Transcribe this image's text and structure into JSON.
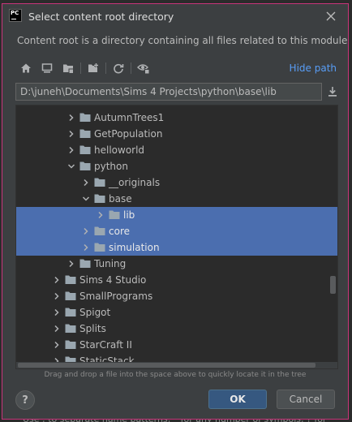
{
  "backdrop": {
    "text": "Use ; to separate name patterns, * for any number of symbols, ? for"
  },
  "dialog": {
    "title": "Select content root directory",
    "description": "Content root is a directory containing all files related to this module",
    "hide_path_label": "Hide path",
    "path_value": "D:\\juneh\\Documents\\Sims 4 Projects\\python\\base\\lib",
    "hint": "Drag and drop a file into the space above to quickly locate it in the tree",
    "help_label": "?",
    "ok_label": "OK",
    "cancel_label": "Cancel"
  },
  "toolbar": {
    "icons": [
      "home-icon",
      "desktop-icon",
      "project-folder-icon",
      "new-folder-icon",
      "refresh-icon",
      "show-hidden-icon"
    ]
  },
  "tree": {
    "rows": [
      {
        "label": "AutumnTrees1",
        "depth": 2,
        "expanded": false,
        "selected": false
      },
      {
        "label": "GetPopulation",
        "depth": 2,
        "expanded": false,
        "selected": false
      },
      {
        "label": "helloworld",
        "depth": 2,
        "expanded": false,
        "selected": false
      },
      {
        "label": "python",
        "depth": 2,
        "expanded": true,
        "selected": false
      },
      {
        "label": "__originals",
        "depth": 3,
        "expanded": false,
        "selected": false
      },
      {
        "label": "base",
        "depth": 3,
        "expanded": true,
        "selected": false
      },
      {
        "label": "lib",
        "depth": 4,
        "expanded": false,
        "selected": true
      },
      {
        "label": "core",
        "depth": 3,
        "expanded": false,
        "selected": true
      },
      {
        "label": "simulation",
        "depth": 3,
        "expanded": false,
        "selected": true
      },
      {
        "label": "Tuning",
        "depth": 2,
        "expanded": false,
        "selected": false
      },
      {
        "label": "Sims 4 Studio",
        "depth": 1,
        "expanded": false,
        "selected": false
      },
      {
        "label": "SmallPrograms",
        "depth": 1,
        "expanded": false,
        "selected": false
      },
      {
        "label": "Spigot",
        "depth": 1,
        "expanded": false,
        "selected": false
      },
      {
        "label": "Splits",
        "depth": 1,
        "expanded": false,
        "selected": false
      },
      {
        "label": "StarCraft II",
        "depth": 1,
        "expanded": false,
        "selected": false
      },
      {
        "label": "StaticStack",
        "depth": 1,
        "expanded": false,
        "selected": false
      }
    ]
  },
  "colors": {
    "accent_border": "#c8347a",
    "selection": "#4b6eaf",
    "link": "#589df6",
    "folder": "#9aa7b0",
    "ok_button": "#365880"
  }
}
